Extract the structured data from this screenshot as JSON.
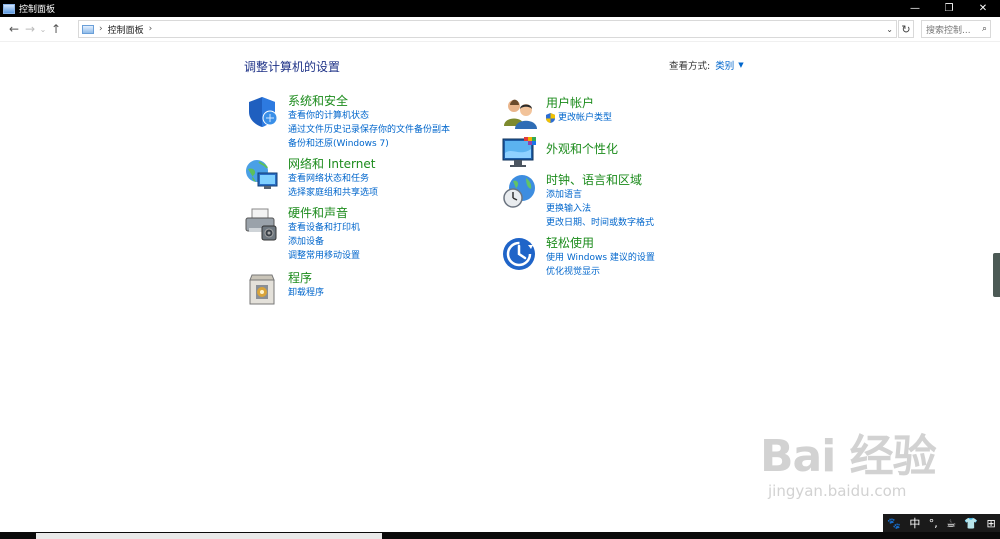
{
  "window": {
    "title": "控制面板"
  },
  "address": {
    "crumb": "控制面板",
    "search_placeholder": "搜索控制..."
  },
  "page": {
    "heading": "调整计算机的设置",
    "view_by_label": "查看方式:",
    "view_by_value": "类别"
  },
  "categories": [
    {
      "title": "系统和安全",
      "links": [
        "查看你的计算机状态",
        "通过文件历史记录保存你的文件备份副本",
        "备份和还原(Windows 7)"
      ]
    },
    {
      "title": "网络和 Internet",
      "links": [
        "查看网络状态和任务",
        "选择家庭组和共享选项"
      ]
    },
    {
      "title": "硬件和声音",
      "links": [
        "查看设备和打印机",
        "添加设备",
        "调整常用移动设置"
      ]
    },
    {
      "title": "程序",
      "links": [
        "卸载程序"
      ]
    },
    {
      "title": "用户帐户",
      "links": [
        "更改帐户类型"
      ]
    },
    {
      "title": "外观和个性化",
      "links": []
    },
    {
      "title": "时钟、语言和区域",
      "links": [
        "添加语言",
        "更换输入法",
        "更改日期、时间或数字格式"
      ]
    },
    {
      "title": "轻松使用",
      "links": [
        "使用 Windows 建议的设置",
        "优化视觉显示"
      ]
    }
  ],
  "watermark": {
    "brand": "Bai 经验",
    "site": "jingyan.baidu.com"
  },
  "tray": {
    "ime": "中"
  },
  "colors": {
    "link": "#0066cc",
    "category": "#1b8b1b",
    "heading": "#1e3287"
  }
}
